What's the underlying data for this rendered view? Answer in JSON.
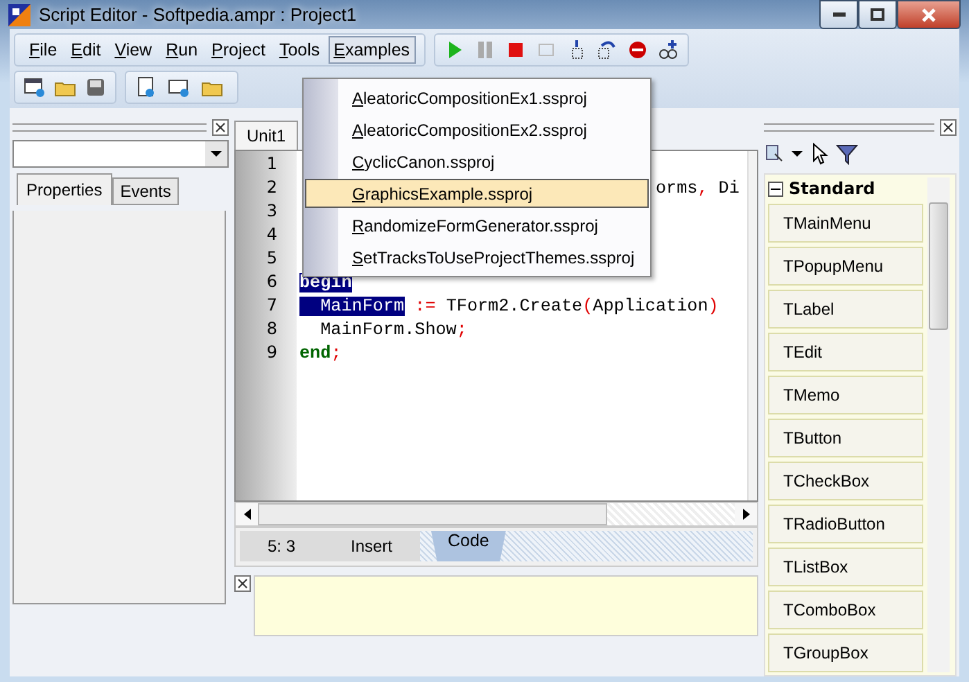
{
  "window": {
    "title": "Script Editor - Softpedia.ampr : Project1"
  },
  "menu": [
    {
      "label": "File",
      "open": false
    },
    {
      "label": "Edit",
      "open": false
    },
    {
      "label": "View",
      "open": false
    },
    {
      "label": "Run",
      "open": false
    },
    {
      "label": "Project",
      "open": false
    },
    {
      "label": "Tools",
      "open": false
    },
    {
      "label": "Examples",
      "open": true
    }
  ],
  "dropdown": [
    {
      "label": "AleatoricCompositionEx1.ssproj",
      "selected": false
    },
    {
      "label": "AleatoricCompositionEx2.ssproj",
      "selected": false
    },
    {
      "label": "CyclicCanon.ssproj",
      "selected": false
    },
    {
      "label": "GraphicsExample.ssproj",
      "selected": true
    },
    {
      "label": "RandomizeFormGenerator.ssproj",
      "selected": false
    },
    {
      "label": "SetTracksToUseProjectThemes.ssproj",
      "selected": false
    }
  ],
  "inspector": {
    "tabs": [
      {
        "label": "Properties",
        "selected": true
      },
      {
        "label": "Events",
        "selected": false
      }
    ]
  },
  "editor": {
    "tab": "Unit1",
    "lines": [
      {
        "number": "1"
      },
      {
        "number": "2",
        "tokens": [
          {
            "text": "                                  orms",
            "kind": "ident"
          },
          {
            "text": ",",
            "kind": "symbol"
          },
          {
            "text": " Di",
            "kind": "ident"
          }
        ]
      },
      {
        "number": "3"
      },
      {
        "number": "4"
      },
      {
        "number": "5"
      },
      {
        "number": "6",
        "tokens": [
          {
            "text": "begin",
            "kind": "keyword",
            "selected": true
          }
        ]
      },
      {
        "number": "7",
        "tokens": [
          {
            "text": "  MainForm",
            "kind": "ident",
            "selected": true
          },
          {
            "text": " :=",
            "kind": "symbol"
          },
          {
            "text": " TForm2.Create",
            "kind": "ident"
          },
          {
            "text": "(",
            "kind": "symbol"
          },
          {
            "text": "Application",
            "kind": "ident"
          },
          {
            "text": ")",
            "kind": "symbol"
          }
        ]
      },
      {
        "number": "8",
        "tokens": [
          {
            "text": "  MainForm.Show",
            "kind": "ident"
          },
          {
            "text": ";",
            "kind": "symbol"
          }
        ]
      },
      {
        "number": "9",
        "tokens": [
          {
            "text": "end",
            "kind": "keyword"
          },
          {
            "text": ";",
            "kind": "symbol"
          }
        ]
      }
    ],
    "position": "5: 3",
    "mode": "Insert",
    "view_tab": "Code"
  },
  "palette": {
    "category": "Standard",
    "expanded": true,
    "items": [
      "TMainMenu",
      "TPopupMenu",
      "TLabel",
      "TEdit",
      "TMemo",
      "TButton",
      "TCheckBox",
      "TRadioButton",
      "TListBox",
      "TComboBox",
      "TGroupBox"
    ]
  }
}
